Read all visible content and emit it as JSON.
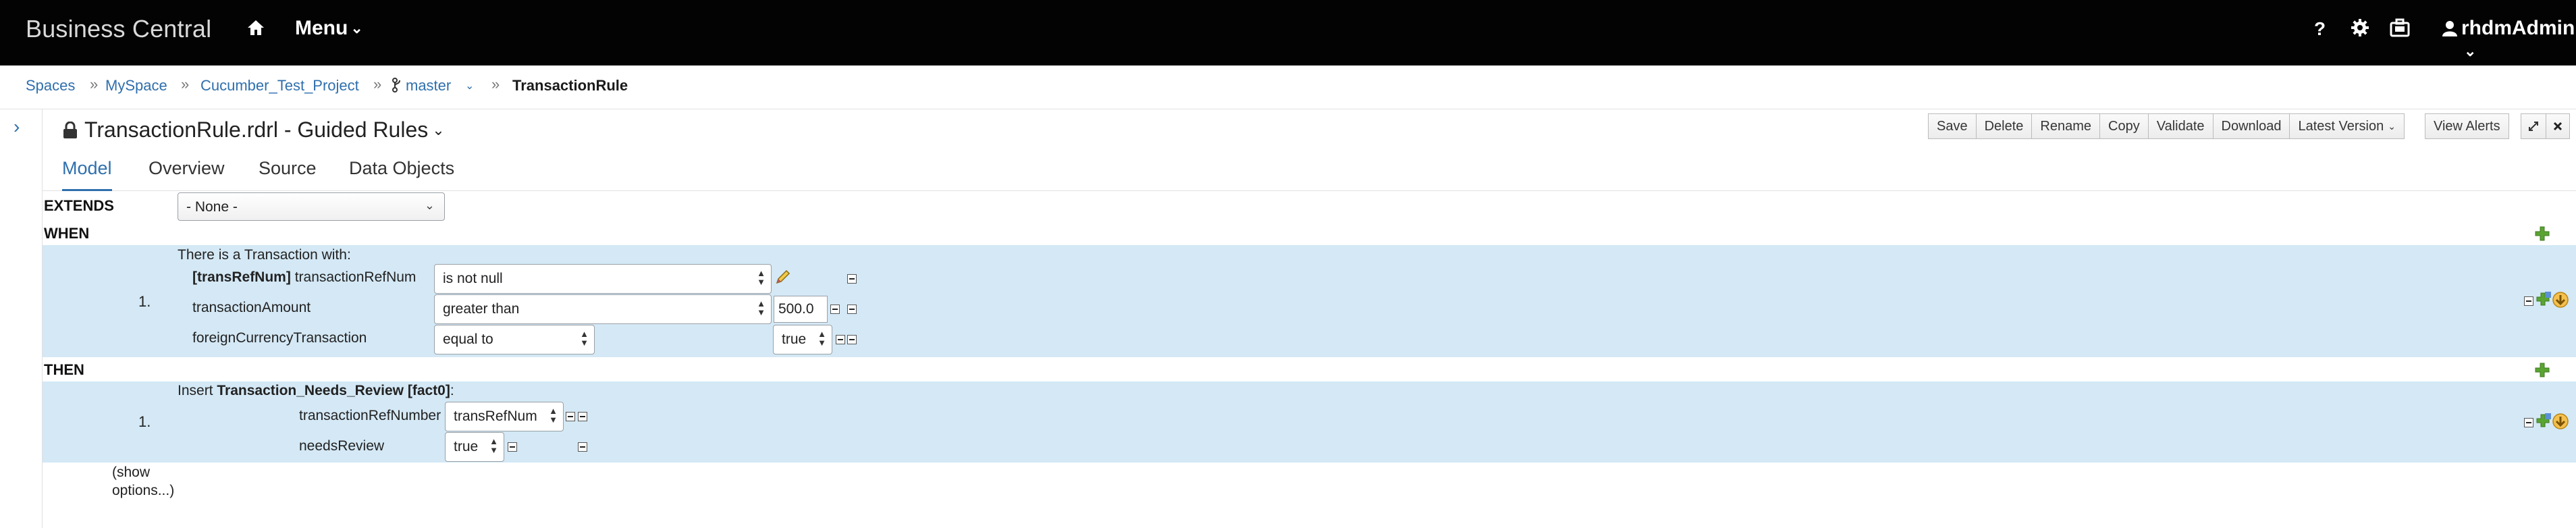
{
  "header": {
    "brand": "Business Central",
    "menu_label": "Menu",
    "user_label": "rhdmAdmin",
    "help_glyph": "?"
  },
  "breadcrumb": {
    "spaces": "Spaces",
    "space": "MySpace",
    "project": "Cucumber_Test_Project",
    "branch": "master",
    "current": "TransactionRule"
  },
  "editor_title": "TransactionRule.rdrl - Guided Rules",
  "toolbar": {
    "save": "Save",
    "delete": "Delete",
    "rename": "Rename",
    "copy": "Copy",
    "validate": "Validate",
    "download": "Download",
    "latest_version": "Latest Version",
    "view_alerts": "View Alerts"
  },
  "tabs": [
    "Model",
    "Overview",
    "Source",
    "Data Objects"
  ],
  "rule": {
    "extends_label": "EXTENDS",
    "extends_value": "- None -",
    "when_label": "WHEN",
    "then_label": "THEN",
    "when_row_number": "1.",
    "fact_intro": "There is a Transaction with:",
    "binding": "[transRefNum]",
    "field1": "transactionRefNum",
    "op1": "is not null",
    "field2": "transactionAmount",
    "op2": "greater than",
    "value2": "500.0",
    "field3": "foreignCurrencyTransaction",
    "op3": "equal to",
    "value3": "true",
    "then_row_number": "1.",
    "insert_prefix": "Insert",
    "insert_fact": "Transaction_Needs_Review [fact0]",
    "insert_suffix": ":",
    "then_field1": "transactionRefNumber",
    "then_value1": "transRefNum",
    "then_field2": "needsReview",
    "then_value2": "true",
    "show_options_line1": "(show",
    "show_options_line2": "options...)"
  },
  "colors": {
    "header_bg": "#030303",
    "link": "#2f6fad",
    "band": "#d4e8f5",
    "add_icon": "#5aa432",
    "move_icon": "#e8a81d"
  }
}
